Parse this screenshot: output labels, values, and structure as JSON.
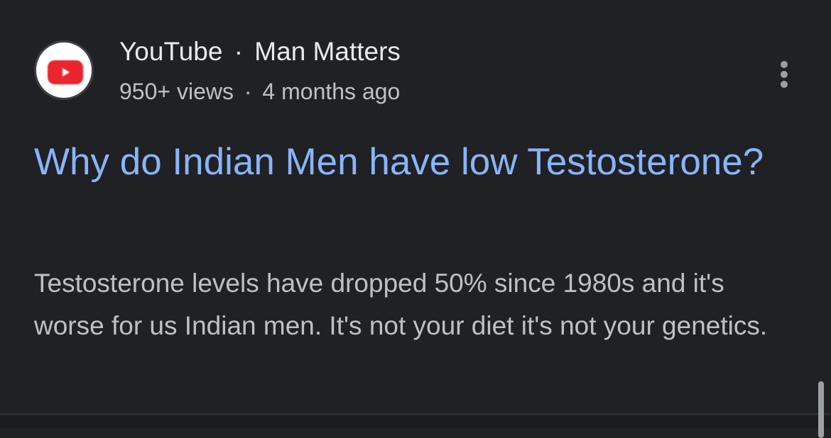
{
  "result": {
    "source_name": "YouTube",
    "separator": "·",
    "channel": "Man Matters",
    "views": "950+ views",
    "age": "4 months ago",
    "title": "Why do Indian Men have low Testosterone?",
    "snippet": "Testosterone levels have dropped 50% since 1980s and it's worse for us Indian men. It's not your diet it's not your genetics.",
    "logo_icon": "youtube-logo-icon",
    "menu_icon": "more-vert-icon"
  },
  "colors": {
    "background": "#202124",
    "title_link": "#8ab4f8",
    "primary_text": "#e8eaed",
    "secondary_text": "#bdc1c6",
    "youtube_red": "#e8262c"
  }
}
